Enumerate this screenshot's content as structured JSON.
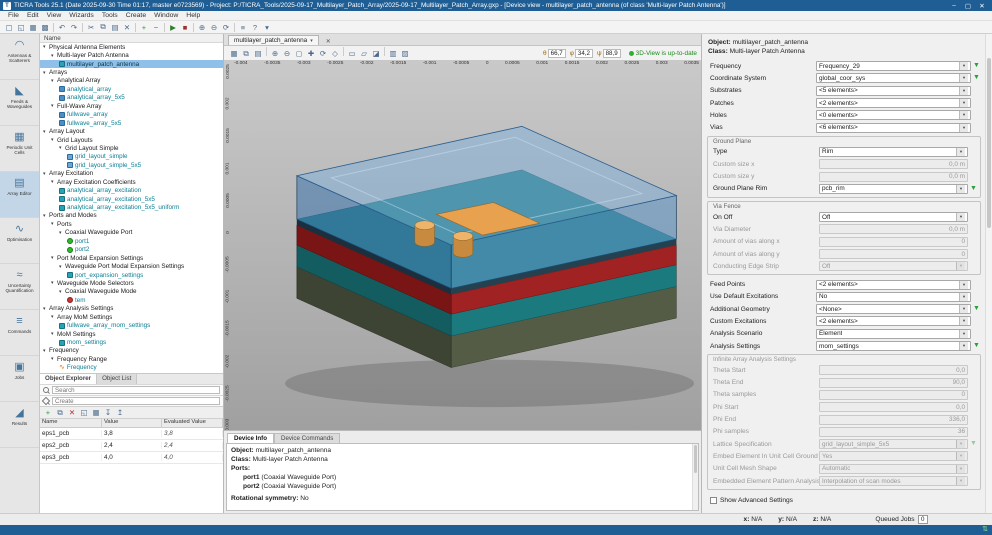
{
  "titlebar": {
    "title": "TICRA Tools 25.1 (Date 2025-09-30 Time 01:17, master e0723569) - Project: P:/TICRA_Tools/2025-09-17_Multilayer_Patch_Array/2025-09-17_Multilayer_Patch_Array.gxp - [Device view - multilayer_patch_antenna (of class 'Multi-layer Patch Antenna')]",
    "minimize": "–",
    "maximize": "▢",
    "close": "✕"
  },
  "menubar": [
    "File",
    "Edit",
    "View",
    "Wizards",
    "Tools",
    "Create",
    "Window",
    "Help"
  ],
  "main_toolbar": [
    {
      "name": "new",
      "glyph": "▢"
    },
    {
      "name": "open",
      "glyph": "◱"
    },
    {
      "name": "save",
      "glyph": "▦"
    },
    {
      "name": "save-all",
      "glyph": "▩"
    },
    {
      "sep": true
    },
    {
      "name": "undo",
      "glyph": "↶"
    },
    {
      "name": "redo",
      "glyph": "↷"
    },
    {
      "sep": true
    },
    {
      "name": "cut",
      "glyph": "✂"
    },
    {
      "name": "copy",
      "glyph": "⧉"
    },
    {
      "name": "paste",
      "glyph": "▤"
    },
    {
      "name": "delete",
      "glyph": "✕"
    },
    {
      "sep": true
    },
    {
      "name": "add",
      "glyph": "+",
      "color": "#2e9e3e"
    },
    {
      "name": "remove",
      "glyph": "−",
      "color": "#b03030"
    },
    {
      "sep": true
    },
    {
      "name": "run",
      "glyph": "▶",
      "color": "#2e7e2e"
    },
    {
      "name": "stop",
      "glyph": "■",
      "color": "#a03030"
    },
    {
      "sep": true
    },
    {
      "name": "zoom-in",
      "glyph": "⊕"
    },
    {
      "name": "zoom-out",
      "glyph": "⊖"
    },
    {
      "name": "refresh",
      "glyph": "⟳"
    },
    {
      "sep": true
    },
    {
      "name": "list",
      "glyph": "≡"
    },
    {
      "name": "help",
      "glyph": "?"
    },
    {
      "name": "more",
      "glyph": "▾"
    }
  ],
  "activity_bar": [
    {
      "name": "antennas-scatterers",
      "label": "Antennas & Scatterers",
      "glyph": "◠"
    },
    {
      "name": "feeds-waveguides",
      "label": "Feeds & Waveguides",
      "glyph": "◣"
    },
    {
      "name": "periodic-unit-cells",
      "label": "Periodic Unit Cells",
      "glyph": "▦"
    },
    {
      "name": "array-editor",
      "label": "Array Editor",
      "glyph": "▤",
      "active": true
    },
    {
      "name": "optimisation",
      "label": "Optimisation",
      "glyph": "∿"
    },
    {
      "name": "uncertainty-quantification",
      "label": "Uncertainty Quantification",
      "glyph": "≈"
    },
    {
      "name": "commands",
      "label": "Commands",
      "glyph": "≡"
    },
    {
      "name": "jobs",
      "label": "Jobs",
      "glyph": "▣"
    },
    {
      "name": "results",
      "label": "Results",
      "glyph": "◢"
    }
  ],
  "tree": {
    "header": "Name",
    "tabs": [
      "Object Explorer",
      "Object List"
    ],
    "items": [
      {
        "l": 0,
        "t": "Physical Antenna Elements",
        "k": "g"
      },
      {
        "l": 1,
        "t": "Multi-layer Patch Antenna",
        "k": "g"
      },
      {
        "l": 2,
        "t": "multilayer_patch_antenna",
        "k": "leaf",
        "i": "cube",
        "sel": true
      },
      {
        "l": 0,
        "t": "Arrays",
        "k": "g"
      },
      {
        "l": 1,
        "t": "Analytical Array",
        "k": "g"
      },
      {
        "l": 2,
        "t": "analytical_array",
        "k": "leaf",
        "i": "array"
      },
      {
        "l": 2,
        "t": "analytical_array_5x5",
        "k": "leaf",
        "i": "array"
      },
      {
        "l": 1,
        "t": "Full-Wave Array",
        "k": "g"
      },
      {
        "l": 2,
        "t": "fullwave_array",
        "k": "leaf",
        "i": "array"
      },
      {
        "l": 2,
        "t": "fullwave_array_5x5",
        "k": "leaf",
        "i": "array"
      },
      {
        "l": 0,
        "t": "Array Layout",
        "k": "g"
      },
      {
        "l": 1,
        "t": "Grid Layouts",
        "k": "g"
      },
      {
        "l": 2,
        "t": "Grid Layout Simple",
        "k": "g"
      },
      {
        "l": 3,
        "t": "grid_layout_simple",
        "k": "leaf",
        "i": "grid"
      },
      {
        "l": 3,
        "t": "grid_layout_simple_5x5",
        "k": "leaf",
        "i": "grid"
      },
      {
        "l": 0,
        "t": "Array Excitation",
        "k": "g"
      },
      {
        "l": 1,
        "t": "Array Excitation Coefficients",
        "k": "g"
      },
      {
        "l": 2,
        "t": "analytical_array_excitation",
        "k": "leaf",
        "i": "exc"
      },
      {
        "l": 2,
        "t": "analytical_array_excitation_5x5",
        "k": "leaf",
        "i": "exc"
      },
      {
        "l": 2,
        "t": "analytical_array_excitation_5x5_uniform",
        "k": "leaf",
        "i": "exc"
      },
      {
        "l": 0,
        "t": "Ports and Modes",
        "k": "g"
      },
      {
        "l": 1,
        "t": "Ports",
        "k": "g"
      },
      {
        "l": 2,
        "t": "Coaxial Waveguide Port",
        "k": "g"
      },
      {
        "l": 3,
        "t": "port1",
        "k": "leaf",
        "i": "port"
      },
      {
        "l": 3,
        "t": "port2",
        "k": "leaf",
        "i": "port"
      },
      {
        "l": 1,
        "t": "Port Modal Expansion Settings",
        "k": "g"
      },
      {
        "l": 2,
        "t": "Waveguide Port Modal Expansion Settings",
        "k": "g"
      },
      {
        "l": 3,
        "t": "port_expansion_settings",
        "k": "leaf",
        "i": "set"
      },
      {
        "l": 1,
        "t": "Waveguide Mode Selectors",
        "k": "g"
      },
      {
        "l": 2,
        "t": "Coaxial Waveguide Mode",
        "k": "g"
      },
      {
        "l": 3,
        "t": "tem",
        "k": "leaf",
        "i": "mode"
      },
      {
        "l": 0,
        "t": "Array Analysis Settings",
        "k": "g"
      },
      {
        "l": 1,
        "t": "Array MoM Settings",
        "k": "g"
      },
      {
        "l": 2,
        "t": "fullwave_array_mom_settings",
        "k": "leaf",
        "i": "mom"
      },
      {
        "l": 1,
        "t": "MoM Settings",
        "k": "g"
      },
      {
        "l": 2,
        "t": "mom_settings",
        "k": "leaf",
        "i": "mom"
      },
      {
        "l": 0,
        "t": "Frequency",
        "k": "g"
      },
      {
        "l": 1,
        "t": "Frequency Range",
        "k": "g"
      },
      {
        "l": 2,
        "t": "Frequency",
        "k": "leaf",
        "i": "freq"
      }
    ]
  },
  "search": {
    "placeholder": "Search"
  },
  "create": {
    "placeholder": "Create"
  },
  "variables": {
    "toolbar": [
      {
        "name": "add",
        "glyph": "+",
        "color": "#2e9e3e"
      },
      {
        "name": "duplicate",
        "glyph": "⧉",
        "color": "#4a6a8a"
      },
      {
        "name": "delete",
        "glyph": "✕",
        "color": "#b03030"
      },
      {
        "name": "open",
        "glyph": "◱",
        "color": "#4a6a8a"
      },
      {
        "name": "save",
        "glyph": "▦",
        "color": "#4a6a8a"
      },
      {
        "name": "import",
        "glyph": "↧",
        "color": "#4a6a8a"
      },
      {
        "name": "export",
        "glyph": "↥",
        "color": "#4a6a8a"
      }
    ],
    "columns": [
      "Name",
      "Value",
      "Evaluated Value"
    ],
    "rows": [
      [
        "eps1_pcb",
        "3,8",
        "3,8"
      ],
      [
        "eps2_pcb",
        "2,4",
        "2,4"
      ],
      [
        "eps3_pcb",
        "4,0",
        "4,0"
      ]
    ]
  },
  "viewport": {
    "tab": "multilayer_patch_antenna",
    "status": "3D-View is up-to-date",
    "tools": [
      {
        "name": "save-view",
        "glyph": "▦"
      },
      {
        "name": "copy-view",
        "glyph": "⧉"
      },
      {
        "name": "print-view",
        "glyph": "▤"
      },
      {
        "sep": true
      },
      {
        "name": "zoom-in",
        "glyph": "⊕"
      },
      {
        "name": "zoom-out",
        "glyph": "⊖"
      },
      {
        "name": "zoom-window",
        "glyph": "◻"
      },
      {
        "name": "pan",
        "glyph": "✚"
      },
      {
        "name": "rotate",
        "glyph": "⟳"
      },
      {
        "name": "fit",
        "glyph": "◇"
      },
      {
        "sep": true
      },
      {
        "name": "view-top",
        "glyph": "▭"
      },
      {
        "name": "view-front",
        "glyph": "▱"
      },
      {
        "name": "view-iso",
        "glyph": "◪"
      },
      {
        "sep": true
      },
      {
        "name": "wireframe",
        "glyph": "▥"
      },
      {
        "name": "shaded",
        "glyph": "▨"
      }
    ],
    "readouts": [
      {
        "name": "theta",
        "icon": "θ",
        "value": "66,7"
      },
      {
        "name": "phi",
        "icon": "φ",
        "value": "34,2"
      },
      {
        "name": "psi",
        "icon": "ψ",
        "value": "88,9"
      }
    ],
    "ruler_top": [
      "-0.004",
      "-0.0035",
      "-0.003",
      "-0.0025",
      "-0.002",
      "-0.0015",
      "-0.001",
      "-0.0005",
      "0",
      "0.0005",
      "0.001",
      "0.0015",
      "0.002",
      "0.0025",
      "0.003",
      "0.0035"
    ],
    "ruler_left": [
      "0.0025",
      "0.002",
      "0.0015",
      "0.001",
      "0.0005",
      "0",
      "-0.0005",
      "-0.001",
      "-0.0015",
      "-0.002",
      "-0.0025",
      "-0.003"
    ]
  },
  "scene": {
    "shadow": "rgba(80,80,80,0.30)",
    "olive_l": "#3e4434",
    "olive_r": "#555c46",
    "teal_l": "#135c60",
    "teal_r": "#1b7a7e",
    "red_l": "#7a1515",
    "red_r": "#a02222",
    "dark_l": "#1b2f3e",
    "dark_r": "#25414f",
    "interior": "#2e8286",
    "patch": "#e8a14f",
    "cyl_side": "#c78a3e",
    "cyl_top": "#edb46a",
    "blue_l": "rgba(52,112,170,0.52)",
    "blue_r": "rgba(86,146,200,0.52)",
    "blue_top": "rgba(118,172,222,0.45)"
  },
  "device_info": {
    "tabs": [
      "Device Info",
      "Device Commands"
    ],
    "object_label": "Object:",
    "object_value": "multilayer_patch_antenna",
    "class_label": "Class:",
    "class_value": "Multi-layer Patch Antenna",
    "ports_label": "Ports:",
    "ports": [
      {
        "name": "port1",
        "rest": " (Coaxial Waveguide Port)"
      },
      {
        "name": "port2",
        "rest": " (Coaxial Waveguide Port)"
      }
    ],
    "rot_label": "Rotational symmetry:",
    "rot_value": "No"
  },
  "properties": {
    "object_label": "Object:",
    "object_value": "multilayer_patch_antenna",
    "class_label": "Class:",
    "class_value": "Multi-layer Patch Antenna",
    "advanced_label": "Show Advanced Settings",
    "sections": [
      {
        "rows": [
          {
            "label": "Frequency",
            "value": "Frequency_29",
            "type": "select",
            "funnel": true
          },
          {
            "label": "Coordinate System",
            "value": "global_coor_sys",
            "type": "select",
            "funnel": true
          },
          {
            "label": "Substrates",
            "value": "<5 elements>",
            "type": "select"
          },
          {
            "label": "Patches",
            "value": "<2 elements>",
            "type": "select"
          },
          {
            "label": "Holes",
            "value": "<0 elements>",
            "type": "select"
          },
          {
            "label": "Vias",
            "value": "<6 elements>",
            "type": "select"
          }
        ]
      },
      {
        "title": "Ground Plane",
        "rows": [
          {
            "label": "Type",
            "value": "Rim",
            "type": "select"
          },
          {
            "label": "Custom size x",
            "value": "0,0 m",
            "type": "input",
            "disabled": true
          },
          {
            "label": "Custom size y",
            "value": "0,0 m",
            "type": "input",
            "disabled": true
          },
          {
            "label": "Ground Plane Rim",
            "value": "pcb_rim",
            "type": "select",
            "funnel": true
          }
        ]
      },
      {
        "title": "Via Fence",
        "rows": [
          {
            "label": "On Off",
            "value": "Off",
            "type": "select"
          },
          {
            "label": "Via Diameter",
            "value": "0,0 m",
            "type": "input",
            "disabled": true
          },
          {
            "label": "Amount of vias along x",
            "value": "0",
            "type": "input",
            "disabled": true
          },
          {
            "label": "Amount of vias along y",
            "value": "0",
            "type": "input",
            "disabled": true
          },
          {
            "label": "Conducting Edge Strip",
            "value": "Off",
            "type": "select",
            "disabled": true
          }
        ]
      },
      {
        "rows": [
          {
            "label": "Feed Points",
            "value": "<2 elements>",
            "type": "select"
          },
          {
            "label": "Use Default Excitations",
            "value": "No",
            "type": "select"
          },
          {
            "label": "Additional Geometry",
            "value": "<None>",
            "type": "select",
            "funnel": true
          },
          {
            "label": "Custom Excitations",
            "value": "<2 elements>",
            "type": "select"
          },
          {
            "label": "Analysis Scenario",
            "value": "Element",
            "type": "select"
          },
          {
            "label": "Analysis Settings",
            "value": "mom_settings",
            "type": "select",
            "funnel": true
          }
        ]
      },
      {
        "title": "Infinite Array Analysis Settings",
        "disabled": true,
        "rows": [
          {
            "label": "Theta Start",
            "value": "0,0",
            "type": "input"
          },
          {
            "label": "Theta End",
            "value": "90,0",
            "type": "input"
          },
          {
            "label": "Theta samples",
            "value": "0",
            "type": "input"
          },
          {
            "label": "Phi Start",
            "value": "0,0",
            "type": "input"
          },
          {
            "label": "Phi End",
            "value": "336,0",
            "type": "input"
          },
          {
            "label": "Phi samples",
            "value": "36",
            "type": "input"
          },
          {
            "label": "Lattice Specification",
            "value": "grid_layout_simple_5x5",
            "type": "select",
            "funnel": true
          },
          {
            "label": "Embed Element In Unit Cell Ground Plane",
            "value": "Yes",
            "type": "select"
          },
          {
            "label": "Unit Cell Mesh Shape",
            "value": "Automatic",
            "type": "select"
          },
          {
            "label": "Embedded Element Pattern Analysis",
            "value": "Interpolation of scan modes",
            "type": "select"
          }
        ]
      }
    ]
  },
  "statusbar": {
    "x_label": "x:",
    "x_value": "N/A",
    "y_label": "y:",
    "y_value": "N/A",
    "z_label": "z:",
    "z_value": "N/A",
    "queued_label": "Queued Jobs",
    "queued_value": "0"
  }
}
